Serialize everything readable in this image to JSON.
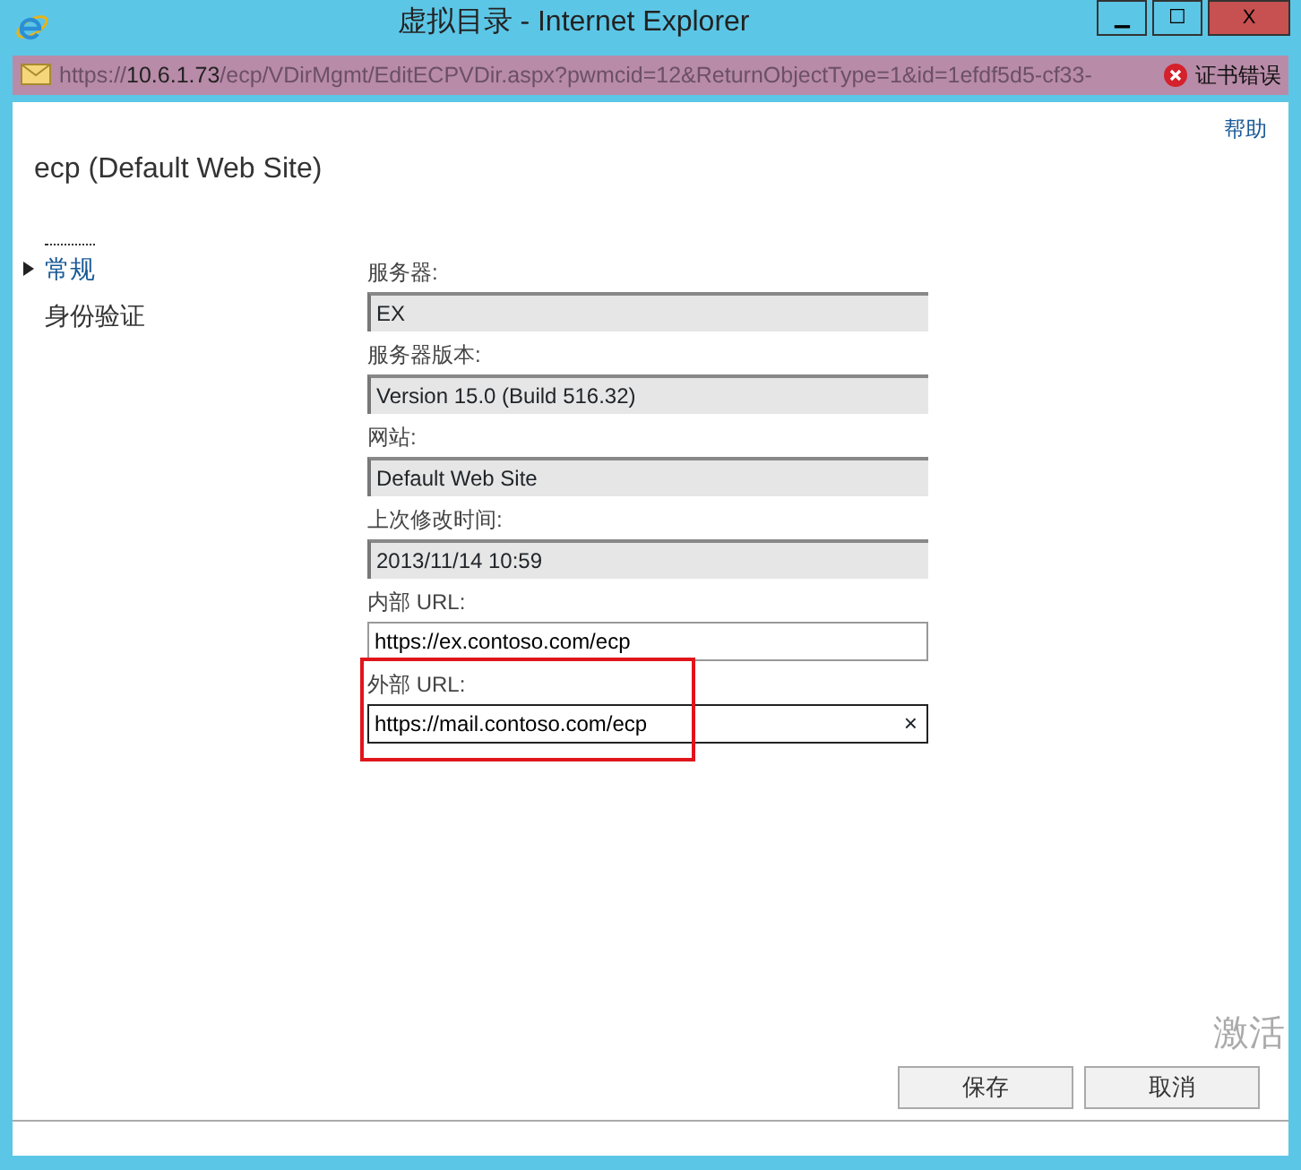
{
  "window": {
    "title": "虚拟目录 - Internet Explorer",
    "controls": [
      "▁",
      "☐",
      "X"
    ]
  },
  "address_bar": {
    "url_prefix": "https://",
    "url_host": "10.6.1.73",
    "url_path": "/ecp/VDirMgmt/EditECPVDir.aspx?pwmcid=12&ReturnObjectType=1&id=1efdf5d5-cf33-",
    "cert_error": "证书错误"
  },
  "help_link": "帮助",
  "page_title": "ecp (Default Web Site)",
  "nav": [
    {
      "label": "常规",
      "selected": true
    },
    {
      "label": "身份验证",
      "selected": false
    }
  ],
  "fields": [
    {
      "label": "服务器:",
      "value": "EX",
      "readonly": true
    },
    {
      "label": "服务器版本:",
      "value": "Version 15.0 (Build 516.32)",
      "readonly": true
    },
    {
      "label": "网站:",
      "value": "Default Web Site",
      "readonly": true
    },
    {
      "label": "上次修改时间:",
      "value": "2013/11/14 10:59",
      "readonly": true
    },
    {
      "label": "内部 URL:",
      "value": "https://ex.contoso.com/ecp",
      "readonly": false,
      "focused": false,
      "highlighted": false
    },
    {
      "label": "外部 URL:",
      "value": "https://mail.contoso.com/ecp",
      "readonly": false,
      "focused": true,
      "highlighted": true,
      "clear_glyph": "×"
    }
  ],
  "buttons": [
    "保存",
    "取消"
  ],
  "activation_notice": "激活"
}
